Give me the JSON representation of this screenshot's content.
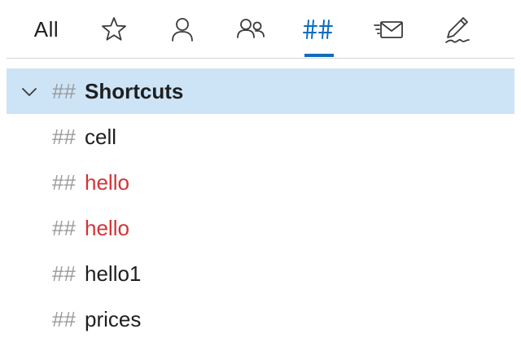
{
  "tabs": {
    "all_label": "All",
    "hashtag_glyph": "##",
    "items": [
      {
        "icon": "all-text"
      },
      {
        "icon": "star-icon"
      },
      {
        "icon": "person-icon"
      },
      {
        "icon": "people-icon"
      },
      {
        "icon": "hashtag-icon",
        "active": true
      },
      {
        "icon": "mail-fast-icon"
      },
      {
        "icon": "pen-sign-icon"
      }
    ]
  },
  "colors": {
    "accent": "#0f6cbd",
    "selected_bg": "#cde4f7",
    "red_text": "#d13438",
    "hash_gray": "#9a9a9a"
  },
  "tree": {
    "hash": "##",
    "group": {
      "label": "Shortcuts",
      "expanded": true
    },
    "items": [
      {
        "label": "cell",
        "color": "default"
      },
      {
        "label": "hello",
        "color": "red"
      },
      {
        "label": "hello",
        "color": "red"
      },
      {
        "label": "hello1",
        "color": "default"
      },
      {
        "label": "prices",
        "color": "default"
      }
    ]
  }
}
